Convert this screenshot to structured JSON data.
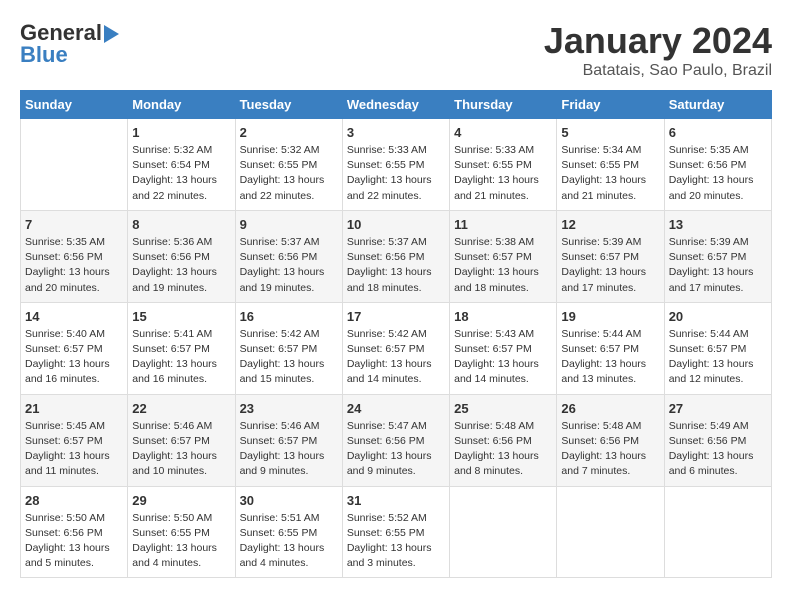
{
  "logo": {
    "general": "General",
    "blue": "Blue"
  },
  "title": {
    "month": "January 2024",
    "location": "Batatais, Sao Paulo, Brazil"
  },
  "days_header": [
    "Sunday",
    "Monday",
    "Tuesday",
    "Wednesday",
    "Thursday",
    "Friday",
    "Saturday"
  ],
  "weeks": [
    [
      {
        "day": "",
        "info": ""
      },
      {
        "day": "1",
        "info": "Sunrise: 5:32 AM\nSunset: 6:54 PM\nDaylight: 13 hours\nand 22 minutes."
      },
      {
        "day": "2",
        "info": "Sunrise: 5:32 AM\nSunset: 6:55 PM\nDaylight: 13 hours\nand 22 minutes."
      },
      {
        "day": "3",
        "info": "Sunrise: 5:33 AM\nSunset: 6:55 PM\nDaylight: 13 hours\nand 22 minutes."
      },
      {
        "day": "4",
        "info": "Sunrise: 5:33 AM\nSunset: 6:55 PM\nDaylight: 13 hours\nand 21 minutes."
      },
      {
        "day": "5",
        "info": "Sunrise: 5:34 AM\nSunset: 6:55 PM\nDaylight: 13 hours\nand 21 minutes."
      },
      {
        "day": "6",
        "info": "Sunrise: 5:35 AM\nSunset: 6:56 PM\nDaylight: 13 hours\nand 20 minutes."
      }
    ],
    [
      {
        "day": "7",
        "info": "Sunrise: 5:35 AM\nSunset: 6:56 PM\nDaylight: 13 hours\nand 20 minutes."
      },
      {
        "day": "8",
        "info": "Sunrise: 5:36 AM\nSunset: 6:56 PM\nDaylight: 13 hours\nand 19 minutes."
      },
      {
        "day": "9",
        "info": "Sunrise: 5:37 AM\nSunset: 6:56 PM\nDaylight: 13 hours\nand 19 minutes."
      },
      {
        "day": "10",
        "info": "Sunrise: 5:37 AM\nSunset: 6:56 PM\nDaylight: 13 hours\nand 18 minutes."
      },
      {
        "day": "11",
        "info": "Sunrise: 5:38 AM\nSunset: 6:57 PM\nDaylight: 13 hours\nand 18 minutes."
      },
      {
        "day": "12",
        "info": "Sunrise: 5:39 AM\nSunset: 6:57 PM\nDaylight: 13 hours\nand 17 minutes."
      },
      {
        "day": "13",
        "info": "Sunrise: 5:39 AM\nSunset: 6:57 PM\nDaylight: 13 hours\nand 17 minutes."
      }
    ],
    [
      {
        "day": "14",
        "info": "Sunrise: 5:40 AM\nSunset: 6:57 PM\nDaylight: 13 hours\nand 16 minutes."
      },
      {
        "day": "15",
        "info": "Sunrise: 5:41 AM\nSunset: 6:57 PM\nDaylight: 13 hours\nand 16 minutes."
      },
      {
        "day": "16",
        "info": "Sunrise: 5:42 AM\nSunset: 6:57 PM\nDaylight: 13 hours\nand 15 minutes."
      },
      {
        "day": "17",
        "info": "Sunrise: 5:42 AM\nSunset: 6:57 PM\nDaylight: 13 hours\nand 14 minutes."
      },
      {
        "day": "18",
        "info": "Sunrise: 5:43 AM\nSunset: 6:57 PM\nDaylight: 13 hours\nand 14 minutes."
      },
      {
        "day": "19",
        "info": "Sunrise: 5:44 AM\nSunset: 6:57 PM\nDaylight: 13 hours\nand 13 minutes."
      },
      {
        "day": "20",
        "info": "Sunrise: 5:44 AM\nSunset: 6:57 PM\nDaylight: 13 hours\nand 12 minutes."
      }
    ],
    [
      {
        "day": "21",
        "info": "Sunrise: 5:45 AM\nSunset: 6:57 PM\nDaylight: 13 hours\nand 11 minutes."
      },
      {
        "day": "22",
        "info": "Sunrise: 5:46 AM\nSunset: 6:57 PM\nDaylight: 13 hours\nand 10 minutes."
      },
      {
        "day": "23",
        "info": "Sunrise: 5:46 AM\nSunset: 6:57 PM\nDaylight: 13 hours\nand 9 minutes."
      },
      {
        "day": "24",
        "info": "Sunrise: 5:47 AM\nSunset: 6:56 PM\nDaylight: 13 hours\nand 9 minutes."
      },
      {
        "day": "25",
        "info": "Sunrise: 5:48 AM\nSunset: 6:56 PM\nDaylight: 13 hours\nand 8 minutes."
      },
      {
        "day": "26",
        "info": "Sunrise: 5:48 AM\nSunset: 6:56 PM\nDaylight: 13 hours\nand 7 minutes."
      },
      {
        "day": "27",
        "info": "Sunrise: 5:49 AM\nSunset: 6:56 PM\nDaylight: 13 hours\nand 6 minutes."
      }
    ],
    [
      {
        "day": "28",
        "info": "Sunrise: 5:50 AM\nSunset: 6:56 PM\nDaylight: 13 hours\nand 5 minutes."
      },
      {
        "day": "29",
        "info": "Sunrise: 5:50 AM\nSunset: 6:55 PM\nDaylight: 13 hours\nand 4 minutes."
      },
      {
        "day": "30",
        "info": "Sunrise: 5:51 AM\nSunset: 6:55 PM\nDaylight: 13 hours\nand 4 minutes."
      },
      {
        "day": "31",
        "info": "Sunrise: 5:52 AM\nSunset: 6:55 PM\nDaylight: 13 hours\nand 3 minutes."
      },
      {
        "day": "",
        "info": ""
      },
      {
        "day": "",
        "info": ""
      },
      {
        "day": "",
        "info": ""
      }
    ]
  ]
}
